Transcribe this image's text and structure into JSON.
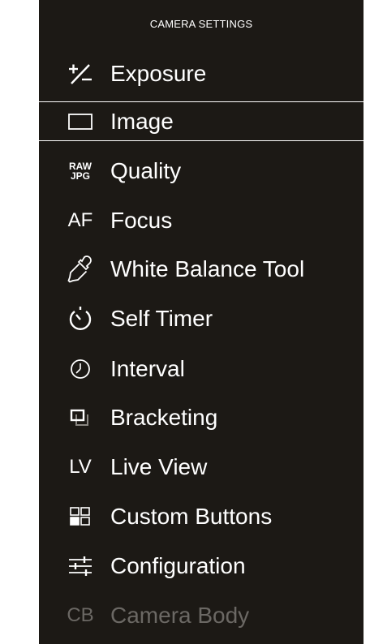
{
  "header": {
    "title": "CAMERA SETTINGS"
  },
  "menu": {
    "items": [
      {
        "label": "Exposure",
        "icon": "exposure-icon"
      },
      {
        "label": "Image",
        "icon": "image-icon",
        "selected": true
      },
      {
        "label": "Quality",
        "icon": "raw-jpg-icon",
        "icon_text_top": "RAW",
        "icon_text_bottom": "JPG"
      },
      {
        "label": "Focus",
        "icon": "af-icon",
        "icon_text": "AF"
      },
      {
        "label": "White Balance Tool",
        "icon": "eyedropper-icon"
      },
      {
        "label": "Self Timer",
        "icon": "self-timer-icon"
      },
      {
        "label": "Interval",
        "icon": "interval-clock-icon"
      },
      {
        "label": "Bracketing",
        "icon": "bracketing-icon"
      },
      {
        "label": "Live View",
        "icon": "lv-icon",
        "icon_text": "LV"
      },
      {
        "label": "Custom Buttons",
        "icon": "custom-buttons-icon"
      },
      {
        "label": "Configuration",
        "icon": "configuration-icon"
      },
      {
        "label": "Camera Body",
        "icon": "cb-icon",
        "icon_text": "CB",
        "disabled": true
      }
    ]
  },
  "colors": {
    "background": "#1c1915",
    "text": "#ffffff",
    "disabled_text": "#6b6864",
    "selection_border": "#ffffff"
  }
}
